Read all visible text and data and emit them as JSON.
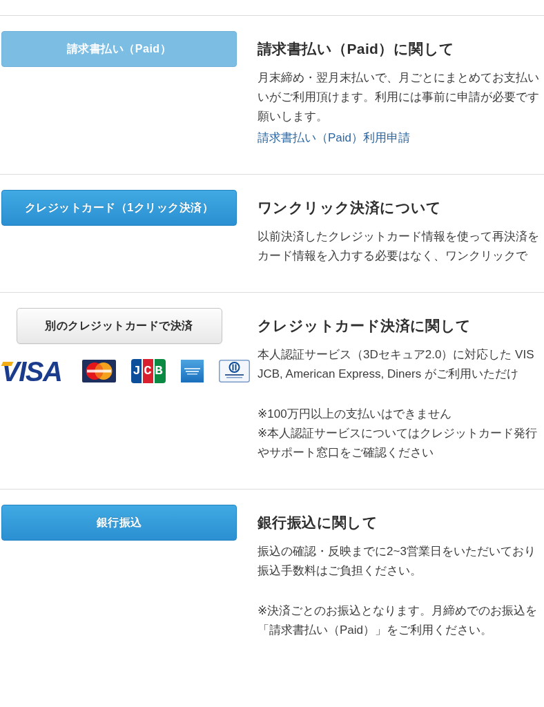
{
  "sections": [
    {
      "button": {
        "label": "請求書払い（Paid）",
        "kind": "primary",
        "disabled": true
      },
      "heading": "請求書払い（Paid）に関して",
      "paragraphs": [
        [
          "月末締め・翌月末払いで、月ごとにまとめてお支払い",
          "いがご利用頂けます。利用には事前に申請が必要です",
          "願いします。"
        ]
      ],
      "link": "請求書払い（Paid）利用申請"
    },
    {
      "button": {
        "label": "クレジットカード（1クリック決済）",
        "kind": "primary",
        "disabled": false
      },
      "heading": "ワンクリック決済について",
      "paragraphs": [
        [
          "以前決済したクレジットカード情報を使って再決済を",
          "カード情報を入力する必要はなく、ワンクリックで"
        ]
      ]
    },
    {
      "button": {
        "label": "別のクレジットカードで決済",
        "kind": "secondary",
        "disabled": false
      },
      "card_logos": [
        {
          "kind": "visa",
          "text": "VISA"
        },
        {
          "kind": "mastercard"
        },
        {
          "kind": "jcb",
          "text": "JCB"
        },
        {
          "kind": "amex"
        },
        {
          "kind": "diners"
        }
      ],
      "heading": "クレジットカード決済に関して",
      "paragraphs": [
        [
          "本人認証サービス（3Dセキュア2.0）に対応した VIS",
          "JCB, American Express, Diners がご利用いただけ"
        ],
        [
          "※100万円以上の支払いはできません",
          "※本人認証サービスについてはクレジットカード発行",
          "やサポート窓口をご確認ください"
        ]
      ]
    },
    {
      "button": {
        "label": "銀行振込",
        "kind": "primary",
        "disabled": false
      },
      "heading": "銀行振込に関して",
      "paragraphs": [
        [
          "振込の確認・反映までに2~3営業日をいただいており",
          "振込手数料はご負担ください。"
        ],
        [
          "※決済ごとのお振込となります。月締めでのお振込を",
          "「請求書払い（Paid）」をご利用ください。"
        ]
      ]
    }
  ]
}
